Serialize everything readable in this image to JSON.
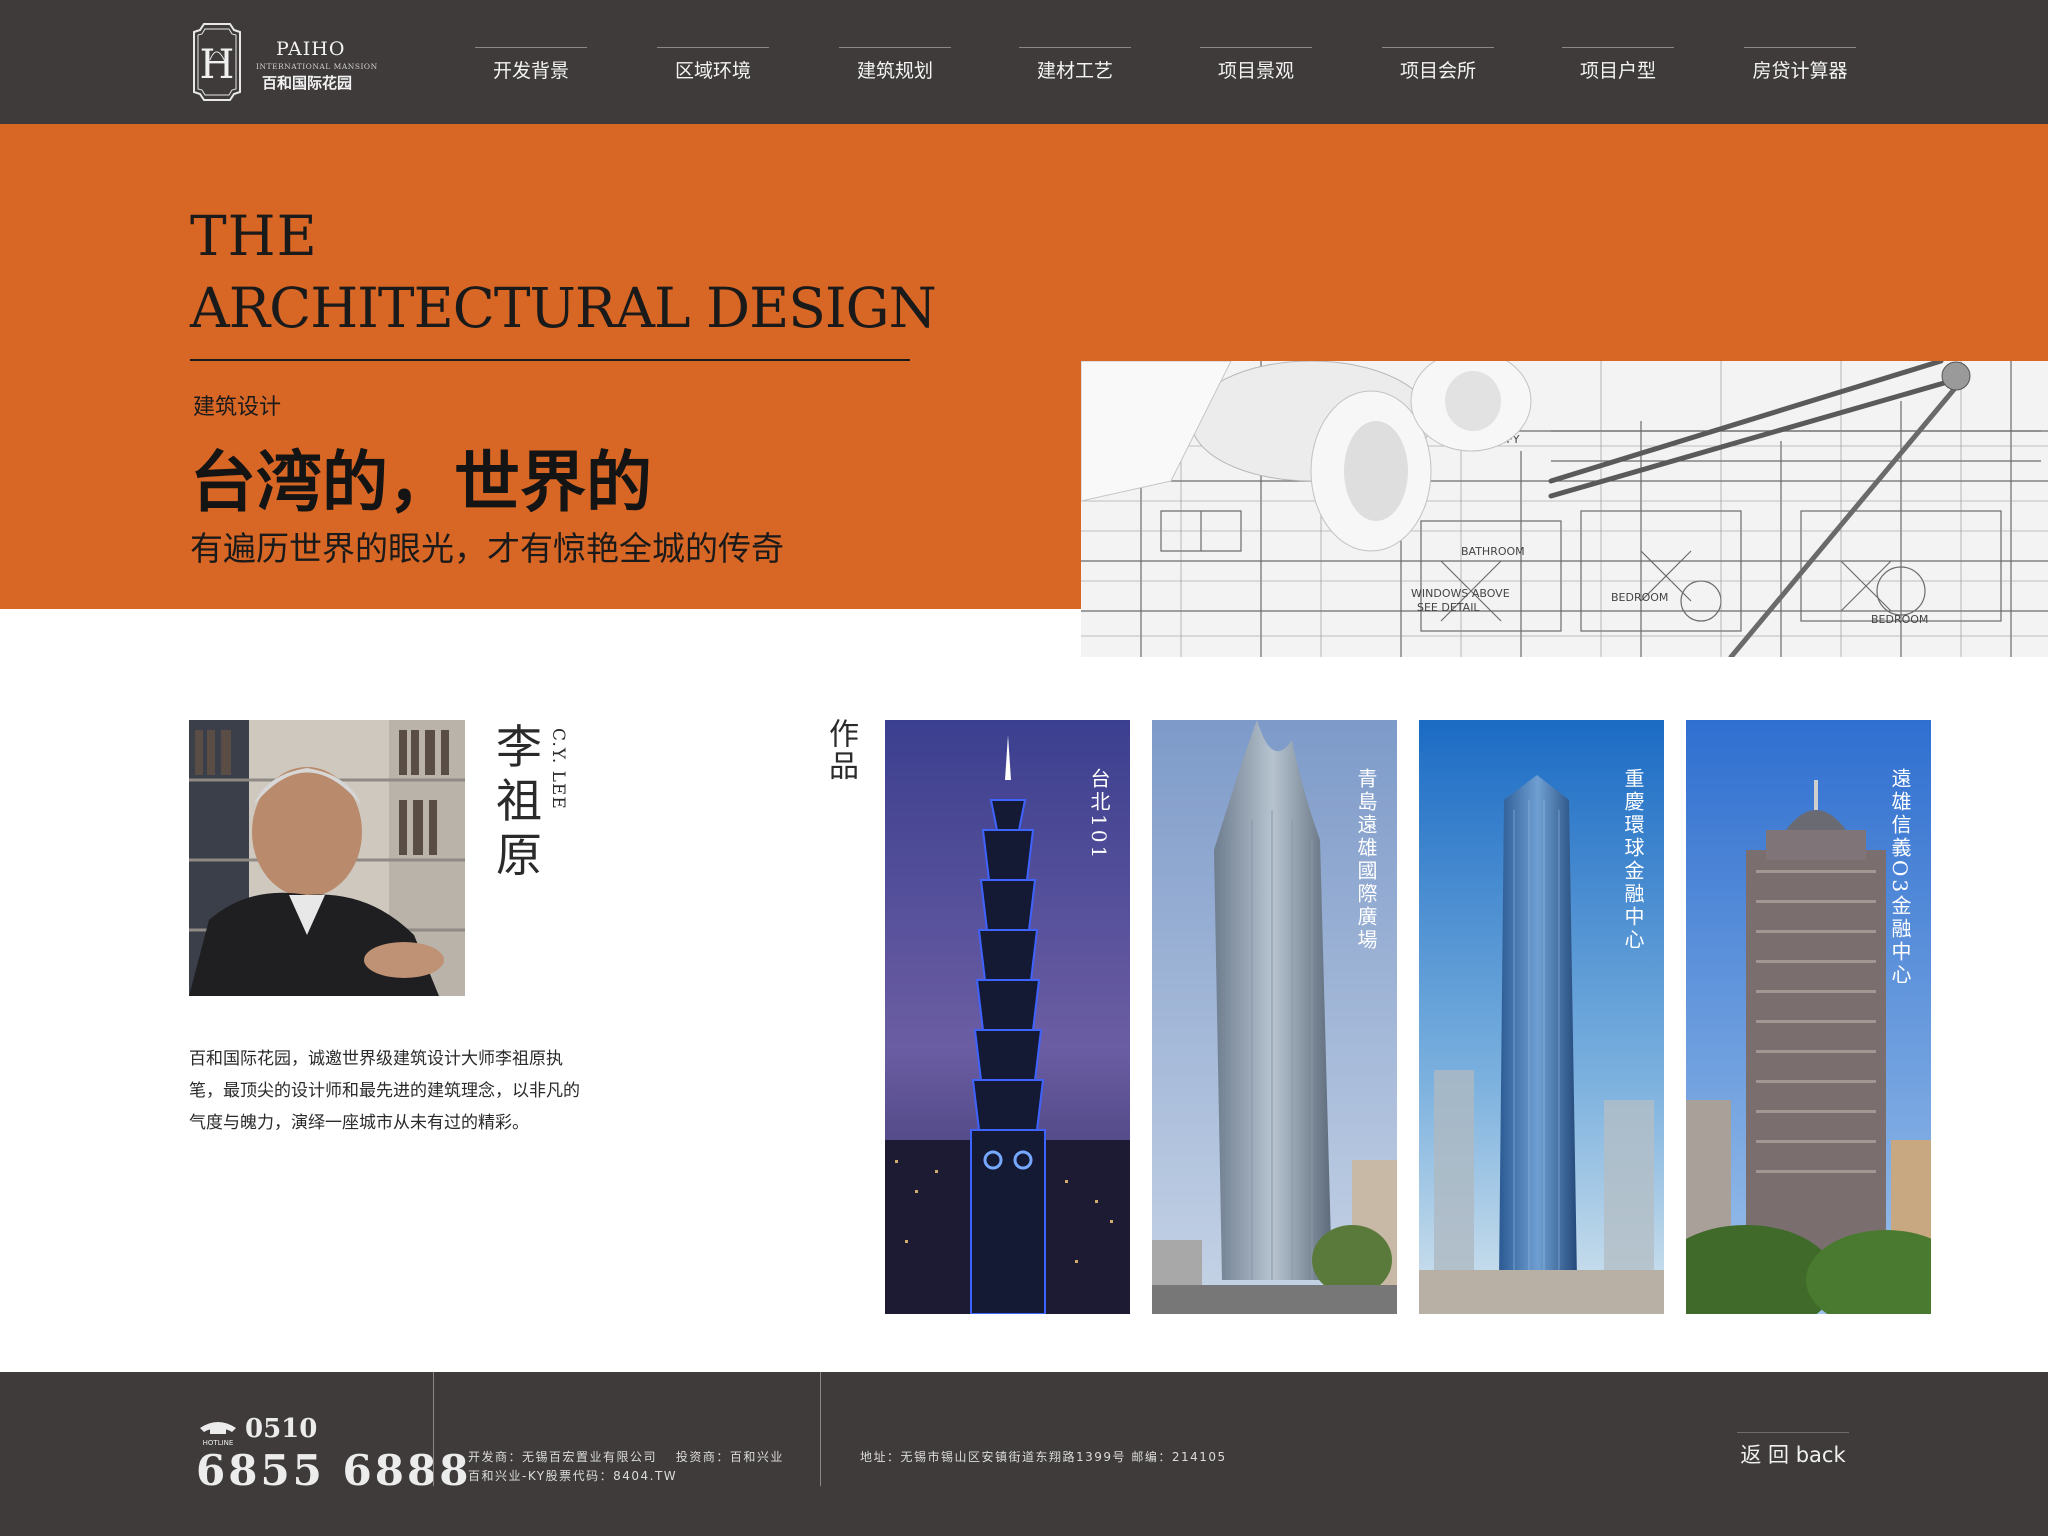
{
  "brand": {
    "name_en": "PAIHO",
    "subtitle_en": "INTERNATIONAL MANSION",
    "name_cn": "百和国际花园",
    "logo_letter": "H"
  },
  "nav": {
    "items": [
      {
        "label": "开发背景"
      },
      {
        "label": "区域环境"
      },
      {
        "label": "建筑规划"
      },
      {
        "label": "建材工艺"
      },
      {
        "label": "项目景观"
      },
      {
        "label": "项目会所"
      },
      {
        "label": "项目户型"
      },
      {
        "label": "房贷计算器"
      }
    ]
  },
  "hero": {
    "title_line1": "THE",
    "title_line2": "ARCHITECTURAL DESIGN",
    "tag": "建筑设计",
    "headline": "台湾的，世界的",
    "subline": "有遍历世界的眼光，才有惊艳全城的传奇",
    "accent_color": "#d86726",
    "blueprint_labels": [
      "BATHROOM",
      "BEDROOM",
      "BEDROOM",
      "WINDOWS ABOVE",
      "SEE DETAIL",
      "VERIFY"
    ]
  },
  "architect": {
    "name_cn": "李祖原",
    "name_en": "C.Y. LEE",
    "bio": "百和国际花园，诚邀世界级建筑设计大师李祖原执笔，最顶尖的设计师和最先进的建筑理念，以非凡的气度与魄力，演绎一座城市从未有过的精彩。"
  },
  "works": {
    "label": "作品",
    "items": [
      {
        "name": "台北101"
      },
      {
        "name": "青島遠雄國際廣場"
      },
      {
        "name": "重慶環球金融中心"
      },
      {
        "name": "遠雄信義O3金融中心"
      }
    ]
  },
  "footer": {
    "hotline_label": "HOTLINE",
    "hotline_prefix": "0510",
    "hotline_number": "6855 6888",
    "developer_line1": "开发商：无锡百宏置业有限公司　 投资商：百和兴业",
    "developer_line2": "百和兴业-KY股票代码：8404.TW",
    "address": "地址：无锡市锡山区安镇街道东翔路1399号 邮编：214105",
    "back_label": "返 回 back"
  },
  "colors": {
    "header_bg": "#3e3b3a",
    "footer_bg": "#3e3b3a",
    "accent": "#d86726"
  }
}
